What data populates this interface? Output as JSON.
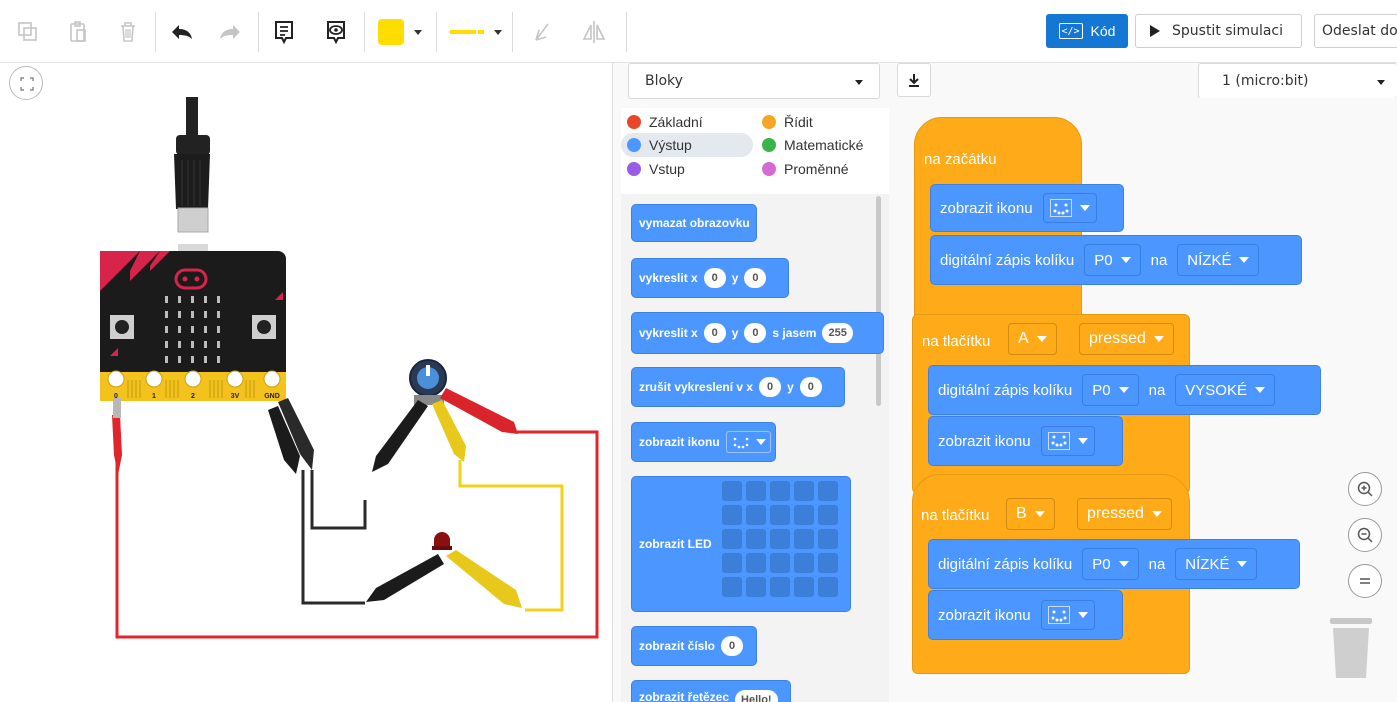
{
  "toolbar": {
    "code_label": "Kód",
    "code_icon_glyph": "</>",
    "simulate_label": "Spustit simulaci",
    "send_label": "Odeslat do",
    "fill_color": "#ffdd00",
    "line_color": "#ffdd00"
  },
  "code_panel": {
    "mode_select": "Bloky",
    "device_select": "1 (micro:bit)"
  },
  "categories": [
    {
      "label": "Základní",
      "color": "#e9472b"
    },
    {
      "label": "Řídit",
      "color": "#f6a623"
    },
    {
      "label": "Výstup",
      "color": "#4c97ff",
      "selected": true
    },
    {
      "label": "Matematické",
      "color": "#3ab54a"
    },
    {
      "label": "Vstup",
      "color": "#9a5ce6"
    },
    {
      "label": "Proměnné",
      "color": "#d56ad3"
    }
  ],
  "palette": {
    "clear_screen": "vymazat obrazovku",
    "plot": {
      "label": "vykreslit x",
      "y_label": "y",
      "x_value": "0",
      "y_value": "0"
    },
    "plot_brightness": {
      "label": "vykreslit x",
      "y_label": "y",
      "x_value": "0",
      "y_value": "0",
      "brightness_label": "s jasem",
      "brightness_value": "255"
    },
    "unplot": {
      "label": "zrušit vykreslení v x",
      "y_label": "y",
      "x_value": "0",
      "y_value": "0"
    },
    "show_icon": "zobrazit ikonu",
    "show_leds": "zobrazit LED",
    "show_number": {
      "label": "zobrazit číslo",
      "value": "0"
    },
    "show_string": {
      "label": "zobrazit řetězec",
      "value": "Hello!"
    }
  },
  "workspace": {
    "on_start": "na začátku",
    "show_icon": "zobrazit ikonu",
    "digital_write": "digitální zápis kolíku",
    "pin": "P0",
    "to_label": "na",
    "low": "NÍZKÉ",
    "high": "VYSOKÉ",
    "on_button": "na tlačítku",
    "button_a": "A",
    "button_b": "B",
    "pressed": "pressed"
  },
  "microbit": {
    "pins": [
      "0",
      "1",
      "2",
      "3V",
      "GND"
    ]
  }
}
